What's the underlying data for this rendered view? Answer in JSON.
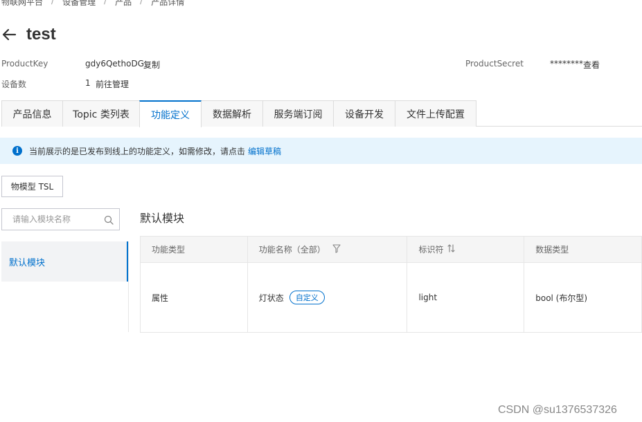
{
  "breadcrumb": [
    "物联网平台",
    "设备管理",
    "产品",
    "产品详情"
  ],
  "page": {
    "title": "test"
  },
  "meta": {
    "product_key_label": "ProductKey",
    "product_key_value": "gdy6QethoDG",
    "copy_label": "复制",
    "product_secret_label": "ProductSecret",
    "product_secret_value": "********",
    "view_label": "查看",
    "device_count_label": "设备数",
    "device_count_value": "1",
    "manage_label": "前往管理"
  },
  "tabs": [
    {
      "label": "产品信息",
      "active": false
    },
    {
      "label": "Topic 类列表",
      "active": false
    },
    {
      "label": "功能定义",
      "active": true
    },
    {
      "label": "数据解析",
      "active": false
    },
    {
      "label": "服务端订阅",
      "active": false
    },
    {
      "label": "设备开发",
      "active": false
    },
    {
      "label": "文件上传配置",
      "active": false
    }
  ],
  "notice": {
    "text": "当前展示的是已发布到线上的功能定义，如需修改，请点击",
    "link": "编辑草稿"
  },
  "tsl_button": "物模型 TSL",
  "search": {
    "placeholder": "请输入模块名称"
  },
  "modules": [
    "默认模块"
  ],
  "section_title": "默认模块",
  "table": {
    "headers": [
      "功能类型",
      "功能名称（全部）",
      "标识符",
      "数据类型"
    ],
    "rows": [
      {
        "type": "属性",
        "name": "灯状态",
        "tag": "自定义",
        "identifier": "light",
        "data_type": "bool (布尔型)"
      }
    ]
  },
  "watermark": "CSDN @su1376537326",
  "colors": {
    "accent": "#0070cc",
    "notice_bg": "#e6f4fd"
  }
}
